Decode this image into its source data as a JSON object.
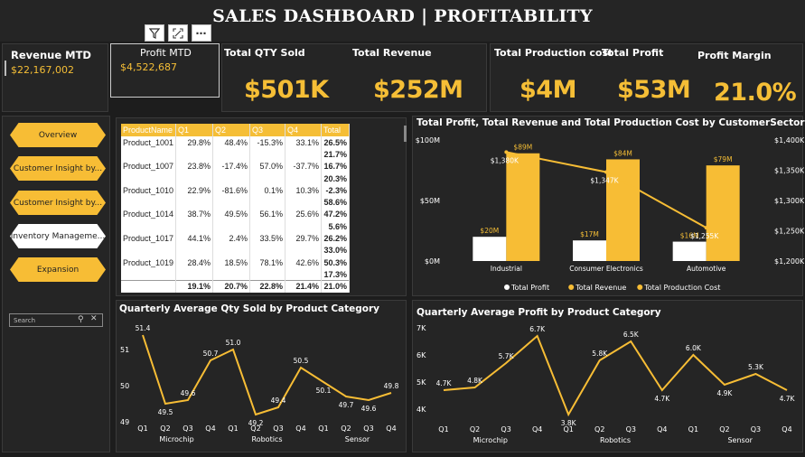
{
  "header": {
    "title": "SALES DASHBOARD | PROFITABILITY"
  },
  "kpis": {
    "revenue_mtd": {
      "label": "Revenue MTD",
      "value": "$22,167,002"
    },
    "profit_mtd": {
      "label": "Profit MTD",
      "value": "$4,522,687"
    },
    "total_qty_sold": {
      "label": "Total QTY Sold",
      "value": "$501K"
    },
    "total_revenue": {
      "label": "Total Revenue",
      "value": "$252M"
    },
    "total_production_cost": {
      "label": "Total Production cost",
      "value": "$4M"
    },
    "total_profit": {
      "label": "Total Profit",
      "value": "$53M"
    },
    "profit_margin": {
      "label": "Profit Margin",
      "value": "21.0%"
    }
  },
  "nav": {
    "items": [
      {
        "label": "Overview",
        "active": false
      },
      {
        "label": "Customer Insight by...",
        "active": false
      },
      {
        "label": "Customer Insight by...",
        "active": false
      },
      {
        "label": "Inventory Manageme...",
        "active": true
      },
      {
        "label": "Expansion",
        "active": false
      }
    ]
  },
  "search": {
    "placeholder": "Search"
  },
  "matrix": {
    "headers": [
      "ProductName",
      "Q1",
      "Q2",
      "Q3",
      "Q4",
      "Total"
    ],
    "rows": [
      [
        "Product_1001",
        "29.8%",
        "48.4%",
        "-15.3%",
        "33.1%",
        "26.5%"
      ],
      [
        "",
        "",
        "",
        "",
        "",
        "21.7%"
      ],
      [
        "Product_1007",
        "23.8%",
        "-17.4%",
        "57.0%",
        "-37.7%",
        "16.7%"
      ],
      [
        "",
        "",
        "",
        "",
        "",
        "20.3%"
      ],
      [
        "Product_1010",
        "22.9%",
        "-81.6%",
        "0.1%",
        "10.3%",
        "-2.3%"
      ],
      [
        "",
        "",
        "",
        "",
        "",
        "58.6%"
      ],
      [
        "Product_1014",
        "38.7%",
        "49.5%",
        "56.1%",
        "25.6%",
        "47.2%"
      ],
      [
        "",
        "",
        "",
        "",
        "",
        "5.6%"
      ],
      [
        "Product_1017",
        "44.1%",
        "2.4%",
        "33.5%",
        "29.7%",
        "26.2%"
      ],
      [
        "",
        "",
        "",
        "",
        "",
        "33.0%"
      ],
      [
        "Product_1019",
        "28.4%",
        "18.5%",
        "78.1%",
        "42.6%",
        "50.3%"
      ],
      [
        "",
        "",
        "",
        "",
        "",
        "17.3%"
      ]
    ],
    "totals": [
      "",
      "19.1%",
      "20.7%",
      "22.8%",
      "21.4%",
      "21.0%"
    ]
  },
  "chart_data": [
    {
      "type": "bar",
      "title": "Total Profit, Total Revenue and Total Production Cost by CustomerSector",
      "categories": [
        "Industrial",
        "Consumer Electronics",
        "Automotive"
      ],
      "series": [
        {
          "name": "Total Profit",
          "values": [
            20,
            17,
            16
          ],
          "labels": [
            "$20M",
            "$17M",
            "$16M"
          ],
          "color": "#ffffff"
        },
        {
          "name": "Total Revenue",
          "values": [
            89,
            84,
            79
          ],
          "labels": [
            "$89M",
            "$84M",
            "$79M"
          ],
          "color": "#f7bd35"
        },
        {
          "name": "Total Production Cost",
          "type": "line",
          "axis": "right",
          "values": [
            1380,
            1347,
            1255
          ],
          "labels": [
            "$1,380K",
            "$1,347K",
            "$1,255K"
          ],
          "color": "#f7bd35"
        }
      ],
      "yticks_left": [
        "$0M",
        "$50M",
        "$100M"
      ],
      "ylim_left": [
        0,
        100
      ],
      "yticks_right": [
        "$1,200K",
        "$1,250K",
        "$1,300K",
        "$1,350K",
        "$1,400K"
      ],
      "ylim_right": [
        1200,
        1400
      ],
      "legend_position": "bottom"
    },
    {
      "type": "line",
      "title": "Quarterly Average Qty Sold by Product Category",
      "x": [
        "Q1",
        "Q2",
        "Q3",
        "Q4",
        "Q1",
        "Q2",
        "Q3",
        "Q4",
        "Q1",
        "Q2",
        "Q3",
        "Q4"
      ],
      "groups": [
        "Microchip",
        "Robotics",
        "Sensor"
      ],
      "values": [
        51.4,
        49.5,
        49.6,
        50.7,
        51.0,
        49.2,
        49.4,
        50.5,
        50.1,
        49.7,
        49.6,
        49.8
      ],
      "labels": [
        "51.4",
        "49.5",
        "49.6",
        "50.7",
        "51.0",
        "49.2",
        "49.4",
        "50.5",
        "50.1",
        "49.7",
        "49.6",
        "49.8"
      ],
      "yticks": [
        "49",
        "50",
        "51"
      ],
      "ylim": [
        49,
        51.5
      ],
      "color": "#f7bd35"
    },
    {
      "type": "line",
      "title": "Quarterly Average Profit by Product Category",
      "x": [
        "Q1",
        "Q2",
        "Q3",
        "Q4",
        "Q1",
        "Q2",
        "Q3",
        "Q4",
        "Q1",
        "Q2",
        "Q3",
        "Q4"
      ],
      "groups": [
        "Microchip",
        "Robotics",
        "Sensor"
      ],
      "values": [
        4.7,
        4.8,
        5.7,
        6.7,
        3.8,
        5.8,
        6.5,
        4.7,
        6.0,
        4.9,
        5.3,
        4.7
      ],
      "labels": [
        "4.7K",
        "4.8K",
        "5.7K",
        "6.7K",
        "3.8K",
        "5.8K",
        "6.5K",
        "4.7K",
        "6.0K",
        "4.9K",
        "5.3K",
        "4.7K"
      ],
      "yticks": [
        "4K",
        "5K",
        "6K",
        "7K"
      ],
      "ylim": [
        4,
        7
      ],
      "color": "#f7bd35"
    }
  ]
}
